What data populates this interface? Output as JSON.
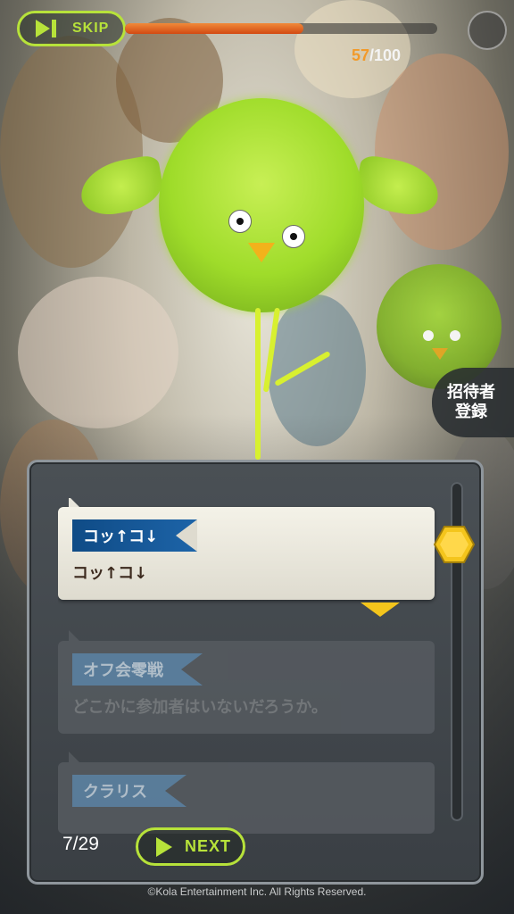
{
  "top_bar": {
    "skip_label": "SKIP",
    "progress_current": "57",
    "progress_total": "/100",
    "progress_fraction": 0.57
  },
  "side_button": {
    "line1": "招待者",
    "line2": "登録"
  },
  "dialog": {
    "entries": [
      {
        "speaker": "コッ↑コ↓",
        "text": "コッ↑コ↓",
        "state": "active"
      },
      {
        "speaker": "オフ会零戦",
        "text": "どこかに参加者はいないだろうか。",
        "state": "dim"
      },
      {
        "speaker": "クラリス",
        "text": "",
        "state": "dim"
      }
    ],
    "page_counter": "7/29",
    "next_label": "NEXT"
  },
  "footer": {
    "copyright": "©Kola Entertainment Inc. All Rights Reserved."
  },
  "colors": {
    "accent_green": "#b7e23a",
    "progress_orange": "#f29a2a",
    "nametag_blue": "#1d64a8",
    "thumb_yellow": "#f4c51c"
  },
  "icons": [
    "play-skip-icon",
    "play-icon",
    "hexagon-scroll-thumb",
    "down-arrow-indicator"
  ]
}
